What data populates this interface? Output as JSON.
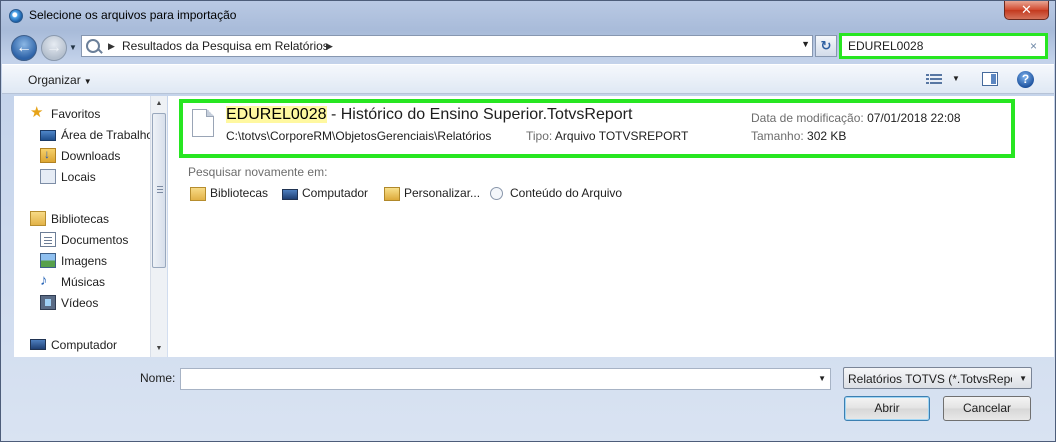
{
  "window": {
    "title": "Selecione os arquivos para importação",
    "close_label": "✕"
  },
  "address": {
    "breadcrumb": "Resultados da Pesquisa em Relatórios",
    "refresh_icon": "refresh-icon"
  },
  "search": {
    "value": "EDUREL0028",
    "clear_label": "×"
  },
  "toolbar": {
    "organize_label": "Organizar",
    "help_label": "?"
  },
  "sidebar": {
    "favorites_label": "Favoritos",
    "favorites_items": [
      "Área de Trabalho",
      "Downloads",
      "Locais"
    ],
    "libraries_label": "Bibliotecas",
    "libraries_items": [
      "Documentos",
      "Imagens",
      "Músicas",
      "Vídeos"
    ],
    "computer_label": "Computador"
  },
  "result": {
    "name_highlight": "EDUREL0028",
    "name_rest": " - Histórico do Ensino Superior.TotvsReport",
    "path": "C:\\totvs\\CorporeRM\\ObjetosGerenciais\\Relatórios",
    "type_key": "Tipo:",
    "type_value": "Arquivo TOTVSREPORT",
    "date_key": "Data de modificação:",
    "date_value": "07/01/2018 22:08",
    "size_key": "Tamanho:",
    "size_value": "302 KB"
  },
  "search_again": {
    "label": "Pesquisar novamente em:",
    "items": [
      "Bibliotecas",
      "Computador",
      "Personalizar...",
      "Conteúdo do Arquivo"
    ]
  },
  "bottom": {
    "name_label": "Nome:",
    "name_value": "",
    "filter_value": "Relatórios TOTVS (*.TotvsRepor",
    "open_label": "Abrir",
    "cancel_label": "Cancelar"
  },
  "colors": {
    "highlight_border": "#27e621",
    "match_highlight": "#fff8a0"
  }
}
